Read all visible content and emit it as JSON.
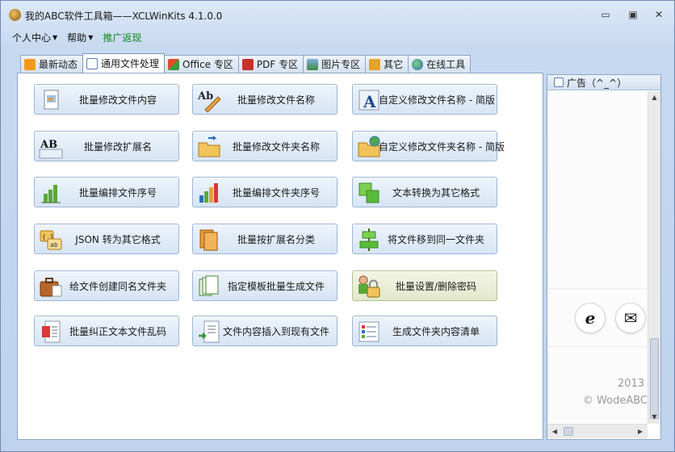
{
  "window": {
    "title": "我的ABC软件工具箱——XCLWinKits  4.1.0.0",
    "minimize_glyph": "▭",
    "restore_glyph": "▣",
    "close_glyph": "✕"
  },
  "menu": {
    "items": [
      {
        "label": "个人中心"
      },
      {
        "label": "帮助"
      },
      {
        "label": "推广返现"
      }
    ]
  },
  "tabs": [
    {
      "label": "最新动态",
      "icon": "rss-icon",
      "color": "#f39a1e"
    },
    {
      "label": "通用文件处理",
      "icon": "document-icon",
      "color": "#5a7db3"
    },
    {
      "label": "Office 专区",
      "icon": "office-icon",
      "color": "#e24a2a"
    },
    {
      "label": "PDF 专区",
      "icon": "pdf-icon",
      "color": "#c8302a"
    },
    {
      "label": "图片专区",
      "icon": "picture-icon",
      "color": "#3f8a3f"
    },
    {
      "label": "其它",
      "icon": "folder-icon",
      "color": "#e4a32a"
    },
    {
      "label": "在线工具",
      "icon": "globe-icon",
      "color": "#2a6fb8"
    }
  ],
  "active_tab": 1,
  "functions": [
    [
      "批量修改文件内容",
      "批量修改文件名称",
      "自定义修改文件名称 - 简版"
    ],
    [
      "批量修改扩展名",
      "批量修改文件夹名称",
      "自定义修改文件夹名称 - 简版"
    ],
    [
      "批量编排文件序号",
      "批量编排文件夹序号",
      "文本转换为其它格式"
    ],
    [
      "JSON 转为其它格式",
      "批量按扩展名分类",
      "将文件移到同一文件夹"
    ],
    [
      "给文件创建同名文件夹",
      "指定模板批量生成文件",
      "批量设置/删除密码"
    ],
    [
      "批量纠正文本文件乱码",
      "文件内容插入到现有文件",
      "生成文件夹内容清单"
    ]
  ],
  "function_icon_text": {
    "rename_file": "Ab",
    "extension": "AB",
    "custom_rename": "A",
    "json_braces": "{ }",
    "json_ab": "ab"
  },
  "ad": {
    "title": "广告（^_^）",
    "year": "2013",
    "copyright": "© WodeABC",
    "ie_glyph": "e",
    "mail_glyph": "✉"
  },
  "colors": {
    "accent": "#5a7db3",
    "promo_text": "#0c8a1e"
  }
}
